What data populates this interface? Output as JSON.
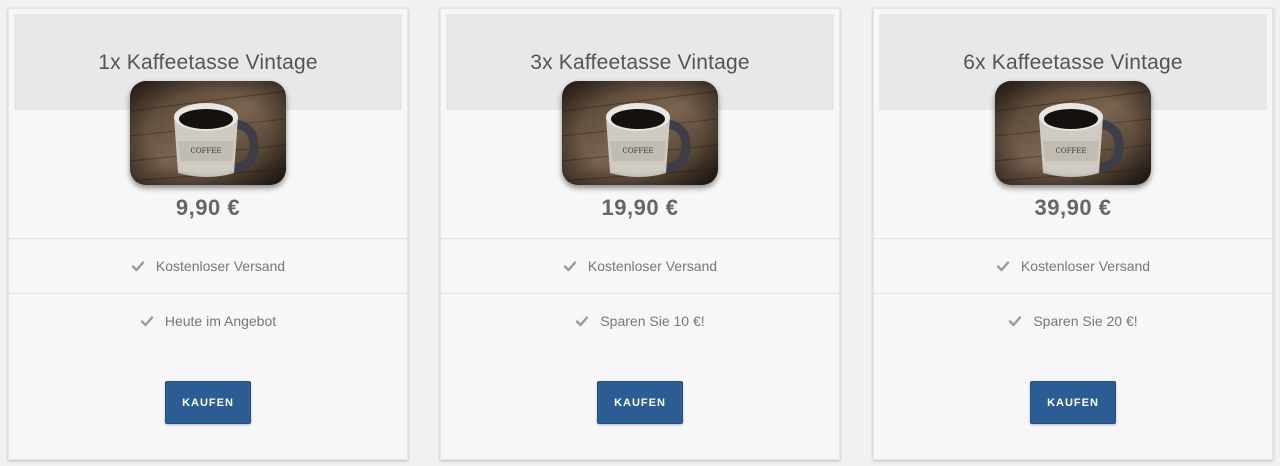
{
  "colors": {
    "background": "#f1f1f1",
    "card": "#f7f7f7",
    "header_band": "#e8e8e8",
    "button": "#2b5d94",
    "text": "#545454",
    "check": "#9a9a9a"
  },
  "cards": [
    {
      "title": "1x Kaffeetasse Vintage",
      "image_icon": "coffee-mug-photo",
      "price": "9,90 €",
      "features": [
        {
          "icon": "check-icon",
          "label": "Kostenloser Versand"
        },
        {
          "icon": "check-icon",
          "label": "Heute im Angebot"
        }
      ],
      "button_label": "KAUFEN"
    },
    {
      "title": "3x Kaffeetasse Vintage",
      "image_icon": "coffee-mug-photo",
      "price": "19,90 €",
      "features": [
        {
          "icon": "check-icon",
          "label": "Kostenloser Versand"
        },
        {
          "icon": "check-icon",
          "label": "Sparen Sie 10 €!"
        }
      ],
      "button_label": "KAUFEN"
    },
    {
      "title": "6x Kaffeetasse Vintage",
      "image_icon": "coffee-mug-photo",
      "price": "39,90 €",
      "features": [
        {
          "icon": "check-icon",
          "label": "Kostenloser Versand"
        },
        {
          "icon": "check-icon",
          "label": "Sparen Sie 20 €!"
        }
      ],
      "button_label": "KAUFEN"
    }
  ]
}
